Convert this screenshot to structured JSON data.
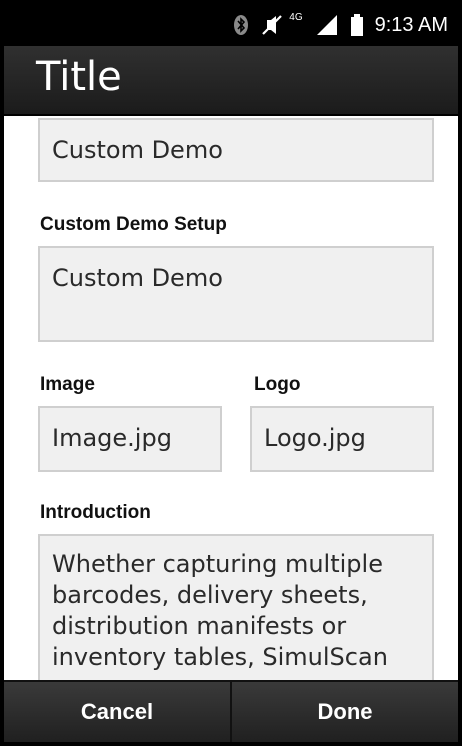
{
  "status_bar": {
    "time": "9:13 AM",
    "network": "4G",
    "icons": [
      "bluetooth-icon",
      "muted-icon",
      "signal-icon",
      "battery-icon"
    ]
  },
  "app_bar": {
    "title": "Title"
  },
  "form": {
    "top_field_value": "Custom Demo",
    "setup": {
      "label": "Custom Demo Setup",
      "value": "Custom Demo"
    },
    "image": {
      "label": "Image",
      "value": "Image.jpg"
    },
    "logo": {
      "label": "Logo",
      "value": "Logo.jpg"
    },
    "introduction": {
      "label": "Introduction",
      "lines": [
        "Whether capturing multiple",
        "barcodes, delivery sheets,",
        "distribution manifests or",
        "inventory tables, SimulScan"
      ]
    }
  },
  "actions": {
    "cancel_label": "Cancel",
    "done_label": "Done"
  },
  "colors": {
    "status_bar_bg": "#000000",
    "title_bar_bg": "#262626",
    "field_bg": "#f0f0f0",
    "field_border": "#cfcfcf",
    "bottom_bar_bg": "#2c2c2c"
  }
}
